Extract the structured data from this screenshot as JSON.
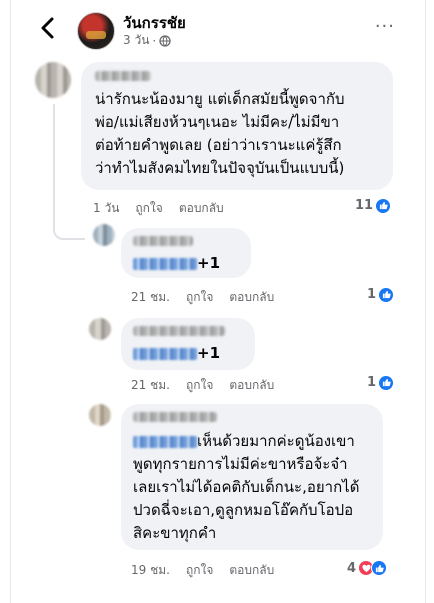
{
  "header": {
    "page_name": "วันกรรชัย",
    "time": "3 วัน",
    "more_label": "···"
  },
  "comments": [
    {
      "text_lines": [
        "น่ารักนะน้องมายู แต่เด็กสมัยนี้พูดจากับ",
        "พ่อ/แม่เสียงห้วนๆเนอะ ไม่มีคะ/ไม่มีขา",
        "ต่อท้ายคำพูดเลย (อย่าว่าเรานะแค่รู้สึก",
        "ว่าทำไมสังคมไทยในปัจจุบันเป็นแบบนี้)"
      ],
      "time": "1 วัน",
      "like_label": "ถูกใจ",
      "reply_label": "ตอบกลับ",
      "reactions": "11"
    },
    {
      "text": "+1",
      "time": "21 ชม.",
      "like_label": "ถูกใจ",
      "reply_label": "ตอบกลับ",
      "reactions": "1"
    },
    {
      "text": "+1",
      "time": "21 ชม.",
      "like_label": "ถูกใจ",
      "reply_label": "ตอบกลับ",
      "reactions": "1"
    },
    {
      "text_lines": [
        "เห็นด้วยมากค่ะดูน้องเขา",
        "พูดทุกรายการไม่มีค่ะขาหรือจ้ะจ๋า",
        "เลยเราไม่ได้อคติกับเด็กนะ,อยากได้",
        "ปวดฉี่จะเอา,ดูลูกหมอโอ๊คกับโอปอ",
        "สิคะขาทุกคำ"
      ],
      "time": "19 ชม.",
      "like_label": "ถูกใจ",
      "reply_label": "ตอบกลับ",
      "reactions": "4"
    }
  ],
  "colors": {
    "like_blue": "#1877f2",
    "love_red": "#f33e58",
    "bubble": "#f0f2f5"
  }
}
